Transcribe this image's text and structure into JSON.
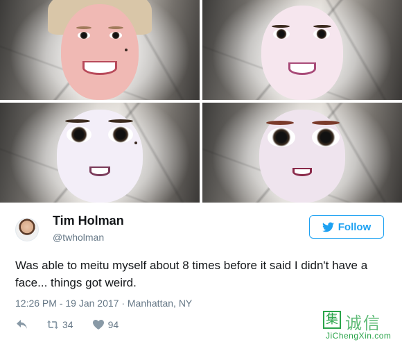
{
  "tweet": {
    "display_name": "Tim Holman",
    "handle": "@twholman",
    "follow_label": "Follow",
    "text": "Was able to meitu myself about 8 times before it said I didn't have a face... things got weird.",
    "meta": "12:26 PM - 19 Jan 2017 · Manhattan, NY",
    "retweets": "34",
    "likes": "94"
  },
  "watermark": {
    "mark": "集",
    "chinese": "诚信",
    "url": "JiChengXin.com"
  },
  "colors": {
    "twitter_blue": "#1da1f2",
    "secondary_text": "#657786",
    "watermark_green": "#2aa44a"
  },
  "icons": [
    "twitter-bird-icon",
    "reply-icon",
    "retweet-icon",
    "heart-icon"
  ]
}
